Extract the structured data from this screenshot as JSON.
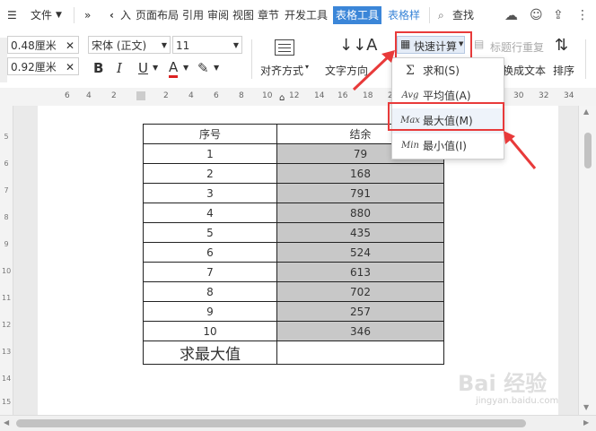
{
  "menubar": {
    "file_label": "文件",
    "tabs": [
      "入",
      "页面布局",
      "引用",
      "审阅",
      "视图",
      "章节",
      "开发工具"
    ],
    "active_tab": "表格工具",
    "extra_tab": "表格样",
    "search_label": "查找"
  },
  "ribbon": {
    "width_value": "0.48厘米",
    "height_value": "0.92厘米",
    "font_name": "宋体 (正文)",
    "font_size": "11",
    "align_label": "对齐方式",
    "text_dir_label": "文字方向",
    "quick_calc_label": "快速计算",
    "header_repeat_label": "标题行重复",
    "to_text_label": "换成文本",
    "sort_label": "排序",
    "bold": "B",
    "italic": "I",
    "underline": "U",
    "font_color": "A"
  },
  "ruler": {
    "ticks": [
      "6",
      "4",
      "2",
      "",
      "2",
      "4",
      "6",
      "8",
      "10",
      "12",
      "14",
      "16",
      "18",
      "20",
      "22",
      "24",
      "26",
      "28",
      "30",
      "32",
      "34"
    ],
    "vticks": [
      "5",
      "6",
      "7",
      "8",
      "9",
      "10",
      "11",
      "12",
      "13",
      "14",
      "15"
    ]
  },
  "dropdown": {
    "items": [
      {
        "icon": "Σ",
        "label": "求和(S)"
      },
      {
        "icon": "Avg",
        "label": "平均值(A)"
      },
      {
        "icon": "Max",
        "label": "最大值(M)"
      },
      {
        "icon": "Min",
        "label": "最小值(I)"
      }
    ]
  },
  "table": {
    "headers": [
      "序号",
      "结余"
    ],
    "rows": [
      [
        "1",
        "79"
      ],
      [
        "2",
        "168"
      ],
      [
        "3",
        "791"
      ],
      [
        "4",
        "880"
      ],
      [
        "5",
        "435"
      ],
      [
        "6",
        "524"
      ],
      [
        "7",
        "613"
      ],
      [
        "8",
        "702"
      ],
      [
        "9",
        "257"
      ],
      [
        "10",
        "346"
      ]
    ],
    "footer_label": "求最大值",
    "footer_value": ""
  },
  "watermark": {
    "main": "Bai 经验",
    "sub": "jingyan.baidu.com"
  },
  "colors": {
    "accent": "#3b86d8",
    "annotation": "#e83a3a",
    "cell_shade": "#c8c8c8"
  }
}
